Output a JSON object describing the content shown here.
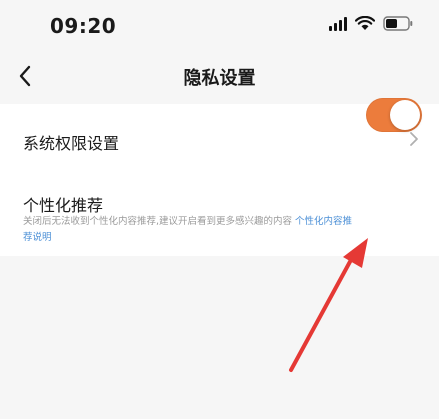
{
  "status_bar": {
    "time": "09:20",
    "icons": [
      "signal-icon",
      "wifi-icon",
      "battery-icon"
    ]
  },
  "header": {
    "title": "隐私设置",
    "back_icon": "chevron-left-icon"
  },
  "settings": {
    "permissions_label": "系统权限设置",
    "personalization": {
      "label": "个性化推荐",
      "description": "关闭后无法收到个性化内容推荐,建议开启看到更多感兴趣的内容 ",
      "link_text": "个性化内容推荐说明",
      "toggle_on": true
    }
  },
  "colors": {
    "toggle_on": "#ec7c3c",
    "link": "#4b8fd6",
    "annotation_arrow": "#e53935",
    "background": "#f6f6f6"
  }
}
